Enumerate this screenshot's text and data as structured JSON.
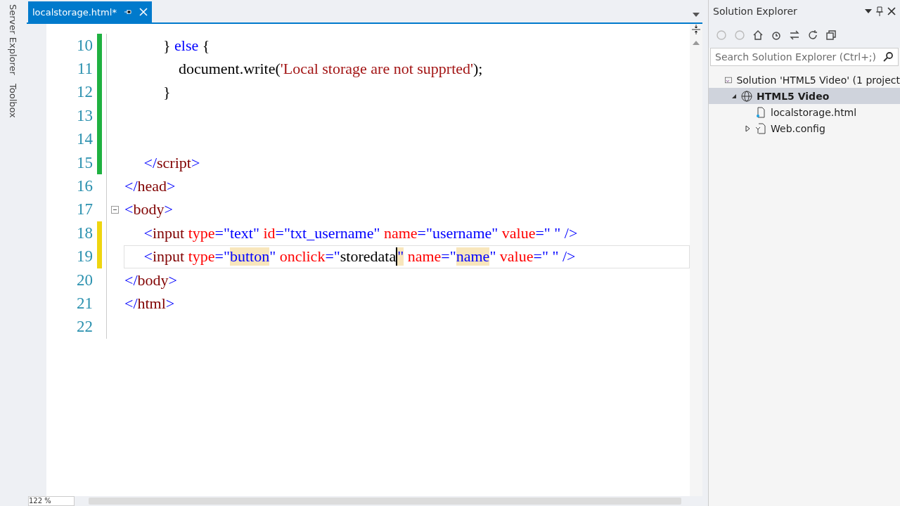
{
  "side_tabs": [
    "Server Explorer",
    "Toolbox"
  ],
  "editor": {
    "tab": {
      "title": "localstorage.html*",
      "selected": true
    },
    "lines": [
      {
        "no": "10",
        "changed": true,
        "saved": true,
        "tokens": [
          {
            "t": "          } ",
            "kind": "text"
          },
          {
            "t": "else",
            "kind": "keyword"
          },
          {
            "t": " {",
            "kind": "text"
          }
        ]
      },
      {
        "no": "11",
        "changed": true,
        "saved": true,
        "tokens": [
          {
            "t": "              document.write(",
            "kind": "text"
          },
          {
            "t": "'Local storage are not supprted'",
            "kind": "string"
          },
          {
            "t": ");",
            "kind": "text"
          }
        ]
      },
      {
        "no": "12",
        "changed": true,
        "saved": true,
        "tokens": [
          {
            "t": "          }",
            "kind": "text"
          }
        ]
      },
      {
        "no": "13",
        "changed": true,
        "saved": true
      },
      {
        "no": "14",
        "changed": true,
        "saved": true
      },
      {
        "no": "15",
        "changed": true,
        "saved": true,
        "tokens": [
          {
            "t": "     </",
            "kind": "bracket"
          },
          {
            "t": "script",
            "kind": "tag"
          },
          {
            "t": ">",
            "kind": "bracket"
          }
        ]
      },
      {
        "no": "16",
        "changed": false,
        "tokens": [
          {
            "t": "</",
            "kind": "bracket"
          },
          {
            "t": "head",
            "kind": "tag"
          },
          {
            "t": ">",
            "kind": "bracket"
          }
        ]
      },
      {
        "no": "17",
        "changed": false,
        "collapsible": true,
        "tokens": [
          {
            "t": "<",
            "kind": "bracket"
          },
          {
            "t": "body",
            "kind": "tag"
          },
          {
            "t": ">",
            "kind": "bracket"
          }
        ]
      },
      {
        "no": "18",
        "changed": true,
        "saved": false,
        "tokens": [
          {
            "t": "     <",
            "kind": "bracket"
          },
          {
            "t": "input",
            "kind": "tag"
          },
          {
            "t": " type",
            "kind": "attr"
          },
          {
            "t": "=\"",
            "kind": "bracket"
          },
          {
            "t": "text",
            "kind": "value"
          },
          {
            "t": "\"",
            "kind": "bracket"
          },
          {
            "t": " id",
            "kind": "attr"
          },
          {
            "t": "=\"",
            "kind": "bracket"
          },
          {
            "t": "txt_username",
            "kind": "value"
          },
          {
            "t": "\"",
            "kind": "bracket"
          },
          {
            "t": " name",
            "kind": "attr"
          },
          {
            "t": "=\"",
            "kind": "bracket"
          },
          {
            "t": "username",
            "kind": "value"
          },
          {
            "t": "\"",
            "kind": "bracket"
          },
          {
            "t": " value",
            "kind": "attr"
          },
          {
            "t": "=\" \" />",
            "kind": "bracket"
          }
        ]
      },
      {
        "no": "19",
        "changed": true,
        "saved": false,
        "current": true,
        "tokens": [
          {
            "t": "     <",
            "kind": "bracket"
          },
          {
            "t": "input",
            "kind": "tag"
          },
          {
            "t": " type",
            "kind": "attr"
          },
          {
            "t": "=\"",
            "kind": "bracket"
          },
          {
            "t": "button",
            "kind": "value",
            "hl": true
          },
          {
            "t": "\"",
            "kind": "bracket"
          },
          {
            "t": " onclick",
            "kind": "attr"
          },
          {
            "t": "=\"",
            "kind": "bracket"
          },
          {
            "t": "storedata",
            "kind": "text",
            "caret": true
          },
          {
            "t": "\"",
            "kind": "bracket",
            "hl": true
          },
          {
            "t": " name",
            "kind": "attr"
          },
          {
            "t": "=\"",
            "kind": "bracket"
          },
          {
            "t": "name",
            "kind": "value",
            "hl": true
          },
          {
            "t": "\"",
            "kind": "bracket"
          },
          {
            "t": " value",
            "kind": "attr"
          },
          {
            "t": "=\" \" />",
            "kind": "bracket"
          }
        ]
      },
      {
        "no": "20",
        "changed": false,
        "tokens": [
          {
            "t": "</",
            "kind": "bracket"
          },
          {
            "t": "body",
            "kind": "tag"
          },
          {
            "t": ">",
            "kind": "bracket"
          }
        ]
      },
      {
        "no": "21",
        "changed": false,
        "tokens": [
          {
            "t": "</",
            "kind": "bracket"
          },
          {
            "t": "html",
            "kind": "tag"
          },
          {
            "t": ">",
            "kind": "bracket"
          }
        ]
      },
      {
        "no": "22",
        "changed": false
      }
    ],
    "zoom": "122 %"
  },
  "solution_explorer": {
    "title": "Solution Explorer",
    "search": {
      "placeholder": "Search Solution Explorer (Ctrl+;)"
    },
    "tree": [
      {
        "label": "Solution 'HTML5 Video' (1 project",
        "kind": "solution",
        "selected": false,
        "children": [
          {
            "label": "HTML5 Video",
            "kind": "project",
            "selected": true,
            "expanded": true,
            "children": [
              {
                "label": "localstorage.html",
                "kind": "file",
                "selected": false
              },
              {
                "label": "Web.config",
                "kind": "config",
                "selected": false,
                "expanded": false
              }
            ]
          }
        ]
      }
    ]
  }
}
